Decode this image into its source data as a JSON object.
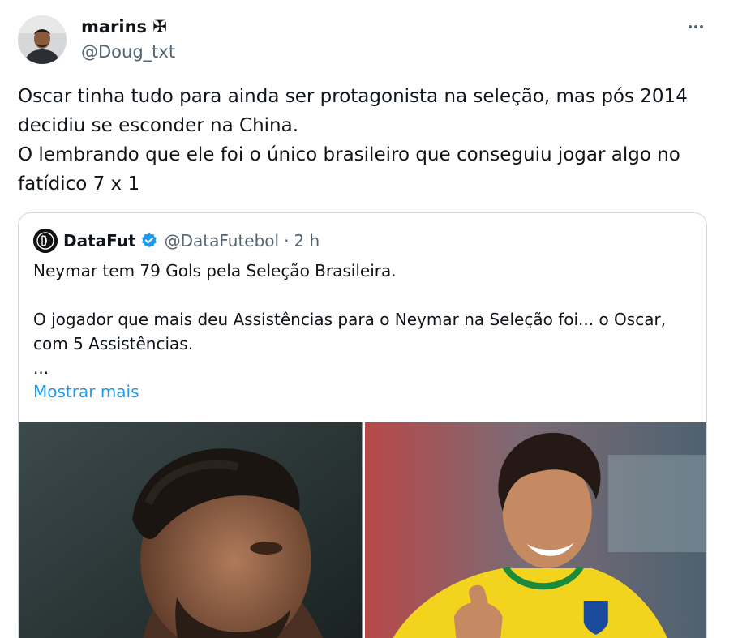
{
  "tweet": {
    "author_name": "marins ✠",
    "author_handle": "@Doug_txt",
    "more_icon": "more-horizontal-icon",
    "text_lines": [
      "Oscar tinha tudo para ainda ser protagonista na seleção, mas pós 2014",
      "decidiu se esconder na China.",
      "O lembrando que ele foi o único brasileiro que conseguiu jogar algo no",
      "fatídico 7 x 1"
    ]
  },
  "quote": {
    "author_name": "DataFut",
    "author_handle": "@DataFutebol",
    "separator": "·",
    "time": "2 h",
    "verified_icon": "verified-badge-icon",
    "text_lines": [
      "Neymar tem 79 Gols pela Seleção Brasileira.",
      "",
      "O jogador que mais deu Assistências para o Neymar na Seleção foi... o Oscar,",
      "com 5 Assistências.",
      "..."
    ],
    "show_more": "Mostrar mais"
  },
  "colors": {
    "text": "#0f1419",
    "secondary": "#536471",
    "link": "#1d9bf0",
    "border": "#cfd9de",
    "brazil_yellow": "#f2d41f",
    "brazil_green": "#1a8a3c"
  }
}
